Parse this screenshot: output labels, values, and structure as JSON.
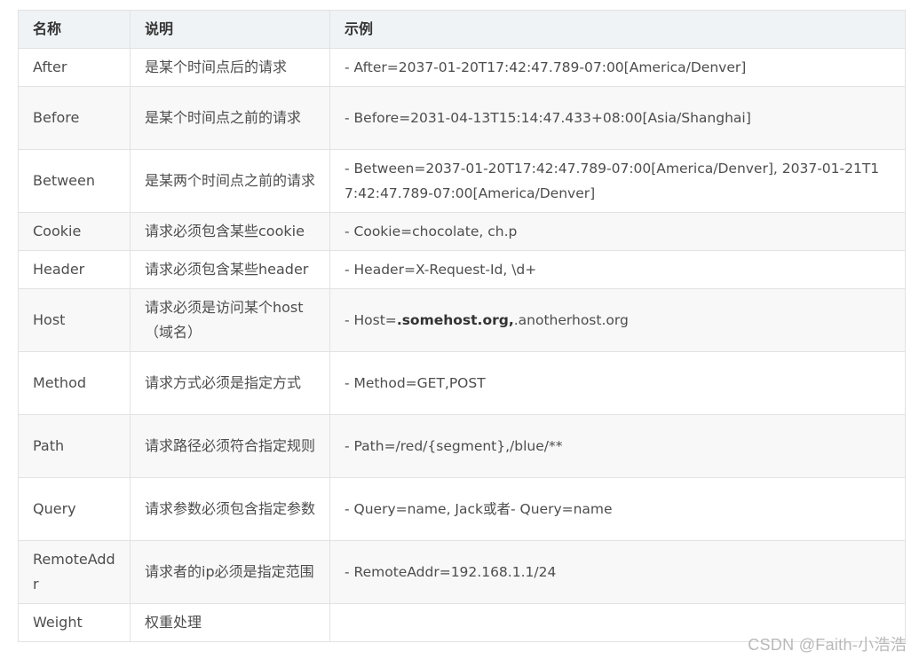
{
  "table": {
    "headers": [
      "名称",
      "说明",
      "示例"
    ],
    "rows": [
      {
        "name": "After",
        "desc": "是某个时间点后的请求",
        "example": "-  After=2037-01-20T17:42:47.789-07:00[America/Denver]"
      },
      {
        "name": "Before",
        "desc": "是某个时间点之前的请求",
        "example": "-  Before=2031-04-13T15:14:47.433+08:00[Asia/Shanghai]"
      },
      {
        "name": "Between",
        "desc": "是某两个时间点之前的请求",
        "example": "-  Between=2037-01-20T17:42:47.789-07:00[America/Denver],  2037-01-21T17:42:47.789-07:00[America/Denver]"
      },
      {
        "name": "Cookie",
        "desc": "请求必须包含某些cookie",
        "example": "- Cookie=chocolate, ch.p"
      },
      {
        "name": "Header",
        "desc": "请求必须包含某些header",
        "example": "- Header=X-Request-Id, \\d+"
      },
      {
        "name": "Host",
        "desc": "请求必须是访问某个host（域名）",
        "example_prefix": "-  Host=",
        "example_bold": ".somehost.org,",
        "example_suffix": ".anotherhost.org"
      },
      {
        "name": "Method",
        "desc": "请求方式必须是指定方式",
        "example": "- Method=GET,POST"
      },
      {
        "name": "Path",
        "desc": "请求路径必须符合指定规则",
        "example": "- Path=/red/{segment},/blue/**"
      },
      {
        "name": "Query",
        "desc": "请求参数必须包含指定参数",
        "example": "- Query=name, Jack或者-  Query=name"
      },
      {
        "name": "RemoteAddr",
        "desc": "请求者的ip必须是指定范围",
        "example": "- RemoteAddr=192.168.1.1/24"
      },
      {
        "name": "Weight",
        "desc": "权重处理",
        "example": ""
      }
    ]
  },
  "watermark": "CSDN @Faith-小浩浩"
}
